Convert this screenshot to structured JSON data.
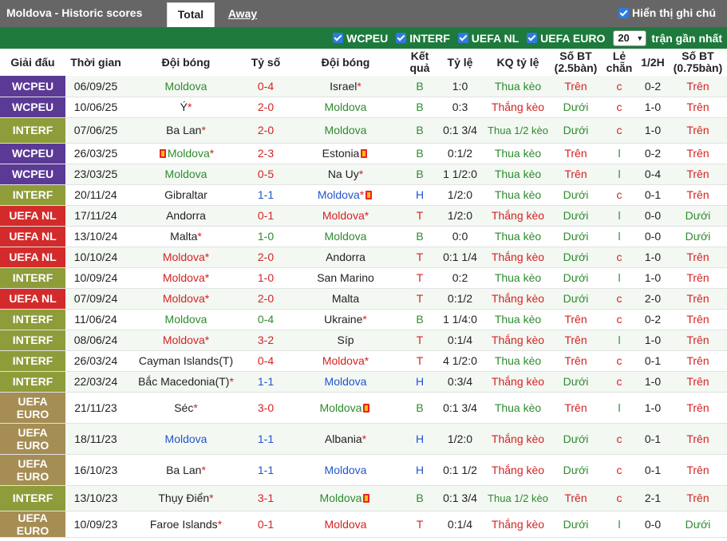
{
  "header": {
    "title": "Moldova - Historic scores",
    "tab_total": "Total",
    "tab_away": "Away",
    "show_notes_label": "Hiển thị ghi chú"
  },
  "filters": {
    "items": [
      "WCPEU",
      "INTERF",
      "UEFA NL",
      "UEFA EURO"
    ],
    "recent_value": "20",
    "recent_label": "trận gần nhất"
  },
  "columns": [
    "Giải đấu",
    "Thời gian",
    "Đội bóng",
    "Tỷ số",
    "Đội bóng",
    "Kết quả",
    "Tỷ lệ",
    "KQ tỷ lệ",
    "Số BT (2.5bàn)",
    "Lẻ chẵn",
    "1/2H",
    "Số BT (0.75bàn)"
  ],
  "rows": [
    {
      "comp": "WCPEU",
      "date": "06/09/25",
      "home": "Moldova",
      "score": "0-4",
      "away": "Israel",
      "result": "B",
      "odds": "1:0",
      "odds_result": "Thua kèo",
      "ou": "Trên",
      "oe": "c",
      "half": "0-2",
      "ou2": "Trên"
    },
    {
      "comp": "WCPEU",
      "date": "10/06/25",
      "home": "Ý",
      "score": "2-0",
      "away": "Moldova",
      "result": "B",
      "odds": "0:3",
      "odds_result": "Thắng kèo",
      "ou": "Dưới",
      "oe": "c",
      "half": "1-0",
      "ou2": "Trên"
    },
    {
      "comp": "INTERF",
      "date": "07/06/25",
      "home": "Ba Lan",
      "score": "2-0",
      "away": "Moldova",
      "result": "B",
      "odds": "0:1 3/4",
      "odds_result": "Thua 1/2 kèo",
      "ou": "Dưới",
      "oe": "c",
      "half": "1-0",
      "ou2": "Trên"
    },
    {
      "comp": "WCPEU",
      "date": "26/03/25",
      "home": "Moldova",
      "score": "2-3",
      "away": "Estonia",
      "result": "B",
      "odds": "0:1/2",
      "odds_result": "Thua kèo",
      "ou": "Trên",
      "oe": "l",
      "half": "0-2",
      "ou2": "Trên"
    },
    {
      "comp": "WCPEU",
      "date": "23/03/25",
      "home": "Moldova",
      "score": "0-5",
      "away": "Na Uy",
      "result": "B",
      "odds": "1 1/2:0",
      "odds_result": "Thua kèo",
      "ou": "Trên",
      "oe": "l",
      "half": "0-4",
      "ou2": "Trên"
    },
    {
      "comp": "INTERF",
      "date": "20/11/24",
      "home": "Gibraltar",
      "score": "1-1",
      "away": "Moldova",
      "result": "H",
      "odds": "1/2:0",
      "odds_result": "Thua kèo",
      "ou": "Dưới",
      "oe": "c",
      "half": "0-1",
      "ou2": "Trên"
    },
    {
      "comp": "UEFA NL",
      "date": "17/11/24",
      "home": "Andorra",
      "score": "0-1",
      "away": "Moldova",
      "result": "T",
      "odds": "1/2:0",
      "odds_result": "Thắng kèo",
      "ou": "Dưới",
      "oe": "l",
      "half": "0-0",
      "ou2": "Dưới"
    },
    {
      "comp": "UEFA NL",
      "date": "13/10/24",
      "home": "Malta",
      "score": "1-0",
      "away": "Moldova",
      "result": "B",
      "odds": "0:0",
      "odds_result": "Thua kèo",
      "ou": "Dưới",
      "oe": "l",
      "half": "0-0",
      "ou2": "Dưới"
    },
    {
      "comp": "UEFA NL",
      "date": "10/10/24",
      "home": "Moldova",
      "score": "2-0",
      "away": "Andorra",
      "result": "T",
      "odds": "0:1 1/4",
      "odds_result": "Thắng kèo",
      "ou": "Dưới",
      "oe": "c",
      "half": "1-0",
      "ou2": "Trên"
    },
    {
      "comp": "INTERF",
      "date": "10/09/24",
      "home": "Moldova",
      "score": "1-0",
      "away": "San Marino",
      "result": "T",
      "odds": "0:2",
      "odds_result": "Thua kèo",
      "ou": "Dưới",
      "oe": "l",
      "half": "1-0",
      "ou2": "Trên"
    },
    {
      "comp": "UEFA NL",
      "date": "07/09/24",
      "home": "Moldova",
      "score": "2-0",
      "away": "Malta",
      "result": "T",
      "odds": "0:1/2",
      "odds_result": "Thắng kèo",
      "ou": "Dưới",
      "oe": "c",
      "half": "2-0",
      "ou2": "Trên"
    },
    {
      "comp": "INTERF",
      "date": "11/06/24",
      "home": "Moldova",
      "score": "0-4",
      "away": "Ukraine",
      "result": "B",
      "odds": "1 1/4:0",
      "odds_result": "Thua kèo",
      "ou": "Trên",
      "oe": "c",
      "half": "0-2",
      "ou2": "Trên"
    },
    {
      "comp": "INTERF",
      "date": "08/06/24",
      "home": "Moldova",
      "score": "3-2",
      "away": "Síp",
      "result": "T",
      "odds": "0:1/4",
      "odds_result": "Thắng kèo",
      "ou": "Trên",
      "oe": "l",
      "half": "1-0",
      "ou2": "Trên"
    },
    {
      "comp": "INTERF",
      "date": "26/03/24",
      "home": "Cayman Islands(T)",
      "score": "0-4",
      "away": "Moldova",
      "result": "T",
      "odds": "4 1/2:0",
      "odds_result": "Thua kèo",
      "ou": "Trên",
      "oe": "c",
      "half": "0-1",
      "ou2": "Trên"
    },
    {
      "comp": "INTERF",
      "date": "22/03/24",
      "home": "Bắc Macedonia(T)",
      "score": "1-1",
      "away": "Moldova",
      "result": "H",
      "odds": "0:3/4",
      "odds_result": "Thắng kèo",
      "ou": "Dưới",
      "oe": "c",
      "half": "1-0",
      "ou2": "Trên"
    },
    {
      "comp": "UEFA EURO",
      "date": "21/11/23",
      "home": "Séc",
      "score": "3-0",
      "away": "Moldova",
      "result": "B",
      "odds": "0:1 3/4",
      "odds_result": "Thua kèo",
      "ou": "Trên",
      "oe": "l",
      "half": "1-0",
      "ou2": "Trên"
    },
    {
      "comp": "UEFA EURO",
      "date": "18/11/23",
      "home": "Moldova",
      "score": "1-1",
      "away": "Albania",
      "result": "H",
      "odds": "1/2:0",
      "odds_result": "Thắng kèo",
      "ou": "Dưới",
      "oe": "c",
      "half": "0-1",
      "ou2": "Trên"
    },
    {
      "comp": "UEFA EURO",
      "date": "16/10/23",
      "home": "Ba Lan",
      "score": "1-1",
      "away": "Moldova",
      "result": "H",
      "odds": "0:1 1/2",
      "odds_result": "Thắng kèo",
      "ou": "Dưới",
      "oe": "c",
      "half": "0-1",
      "ou2": "Trên"
    },
    {
      "comp": "INTERF",
      "date": "13/10/23",
      "home": "Thụy Điển",
      "score": "3-1",
      "away": "Moldova",
      "result": "B",
      "odds": "0:1 3/4",
      "odds_result": "Thua 1/2 kèo",
      "ou": "Trên",
      "oe": "c",
      "half": "2-1",
      "ou2": "Trên"
    },
    {
      "comp": "UEFA EURO",
      "date": "10/09/23",
      "home": "Faroe Islands",
      "score": "0-1",
      "away": "Moldova",
      "result": "T",
      "odds": "0:1/4",
      "odds_result": "Thắng kèo",
      "ou": "Dưới",
      "oe": "l",
      "half": "0-0",
      "ou2": "Dưới"
    }
  ]
}
